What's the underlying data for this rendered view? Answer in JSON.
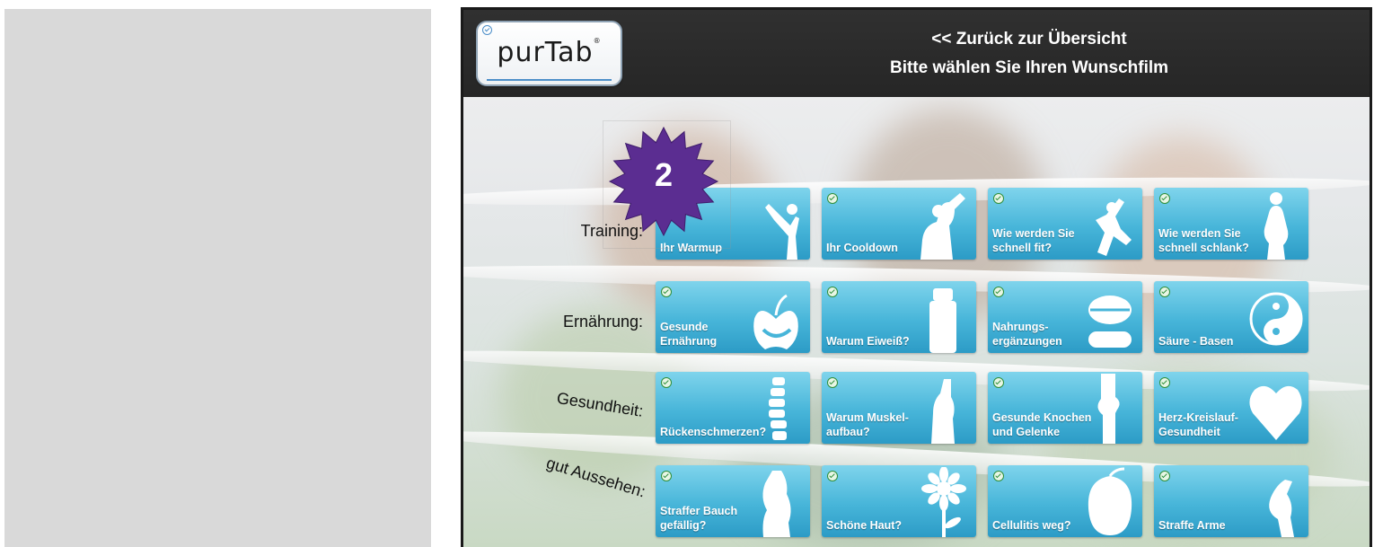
{
  "header": {
    "back_link": "<<  Zurück zur Übersicht",
    "subtitle": "Bitte wählen Sie Ihren Wunschfilm",
    "logo_text": "purTab",
    "logo_reg": "®"
  },
  "badge": {
    "number": "2"
  },
  "rows": [
    {
      "label": "Training:",
      "tiles": [
        {
          "label_1": "Ihr Warmup",
          "label_2": "",
          "icon": "stretching-figure-icon"
        },
        {
          "label_1": "Ihr Cooldown",
          "label_2": "",
          "icon": "drinking-figure-icon"
        },
        {
          "label_1": "Wie werden Sie",
          "label_2": "schnell fit?",
          "icon": "jumping-figure-icon"
        },
        {
          "label_1": "Wie werden Sie",
          "label_2": "schnell schlank?",
          "icon": "slim-figure-icon"
        }
      ]
    },
    {
      "label": "Ernährung:",
      "tiles": [
        {
          "label_1": "Gesunde",
          "label_2": "Ernährung",
          "icon": "apple-icon"
        },
        {
          "label_1": "Warum Eiweiß?",
          "label_2": "",
          "icon": "shaker-bottle-icon"
        },
        {
          "label_1": "Nahrungs-",
          "label_2": "ergänzungen",
          "icon": "pill-icon"
        },
        {
          "label_1": "Säure - Basen",
          "label_2": "",
          "icon": "yin-yang-icon"
        }
      ]
    },
    {
      "label": "Gesundheit:",
      "tiles": [
        {
          "label_1": "Rückenschmerzen?",
          "label_2": "",
          "icon": "spine-icon"
        },
        {
          "label_1": "Warum Muskel-",
          "label_2": "aufbau?",
          "icon": "flexing-arm-icon"
        },
        {
          "label_1": "Gesunde Knochen",
          "label_2": "und Gelenke",
          "icon": "knee-joint-icon"
        },
        {
          "label_1": "Herz-Kreislauf-",
          "label_2": "Gesundheit",
          "icon": "heart-icon"
        }
      ]
    },
    {
      "label": "gut Aussehen:",
      "tiles": [
        {
          "label_1": "Straffer Bauch",
          "label_2": "gefällig?",
          "icon": "torso-icon"
        },
        {
          "label_1": "Schöne Haut?",
          "label_2": "",
          "icon": "flower-icon"
        },
        {
          "label_1": "Cellulitis weg?",
          "label_2": "",
          "icon": "peach-icon"
        },
        {
          "label_1": "Straffe Arme",
          "label_2": "",
          "icon": "arm-icon"
        }
      ]
    }
  ],
  "colors": {
    "tile_top": "#7fd4ec",
    "tile_bottom": "#2c9bc6",
    "header_bg": "#2b2b2b",
    "badge": "#5b2d91"
  }
}
